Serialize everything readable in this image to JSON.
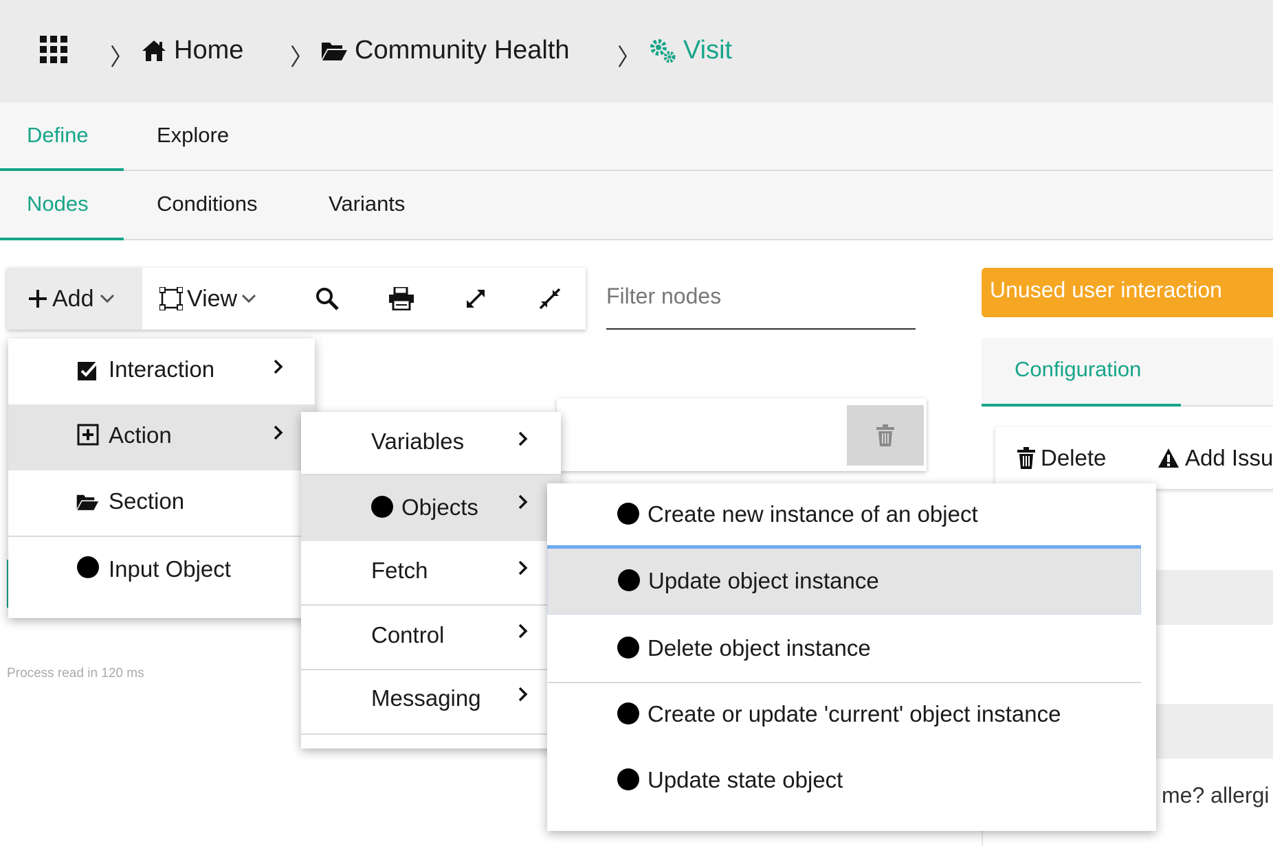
{
  "breadcrumb": {
    "apps_icon": "apps-grid-icon",
    "items": [
      {
        "label": "Home",
        "icon": "home-icon"
      },
      {
        "label": "Community Health",
        "icon": "folder-open-icon"
      },
      {
        "label": "Visit",
        "icon": "gears-icon"
      }
    ],
    "separator": "〉"
  },
  "tabs_primary": [
    {
      "label": "Define",
      "active": true
    },
    {
      "label": "Explore",
      "active": false
    }
  ],
  "tabs_secondary": [
    {
      "label": "Nodes",
      "active": true
    },
    {
      "label": "Conditions",
      "active": false
    },
    {
      "label": "Variants",
      "active": false
    }
  ],
  "toolbar": {
    "add_label": "Add",
    "view_label": "View",
    "tools": [
      "search-icon",
      "print-icon",
      "expand-icon",
      "compress-icon"
    ]
  },
  "filter": {
    "placeholder": "Filter nodes"
  },
  "status": {
    "unused_label": "Unused user interaction"
  },
  "config": {
    "tab_label": "Configuration"
  },
  "right_toolbar": {
    "delete_label": "Delete",
    "add_issue_label": "Add Issu"
  },
  "right_partial_text": "me? allergi",
  "process_text": "Process read in 120 ms",
  "menu_add": {
    "items": [
      {
        "label": "Interaction",
        "icon": "checkbox-checked-icon",
        "submenu": true
      },
      {
        "label": "Action",
        "icon": "plus-square-icon",
        "submenu": true,
        "highlighted": true
      },
      {
        "label": "Section",
        "icon": "folder-open-icon",
        "submenu": false
      },
      {
        "label": "Input Object",
        "icon": "circle-icon",
        "submenu": false
      }
    ]
  },
  "menu_action": {
    "items": [
      {
        "label": "Variables"
      },
      {
        "label": "Objects",
        "highlighted": true
      },
      {
        "label": "Fetch"
      },
      {
        "label": "Control"
      },
      {
        "label": "Messaging"
      }
    ]
  },
  "menu_objects": {
    "items": [
      {
        "label": "Create new instance of an object"
      },
      {
        "label": "Update object instance",
        "highlighted": true
      },
      {
        "label": "Delete object instance"
      },
      {
        "label": "Create or update 'current' object instance"
      },
      {
        "label": "Update state object"
      }
    ]
  },
  "colors": {
    "accent": "#17a589",
    "warning": "#f5a623",
    "header_bg": "#ebebeb",
    "focus_blue": "#6fa8f0"
  }
}
